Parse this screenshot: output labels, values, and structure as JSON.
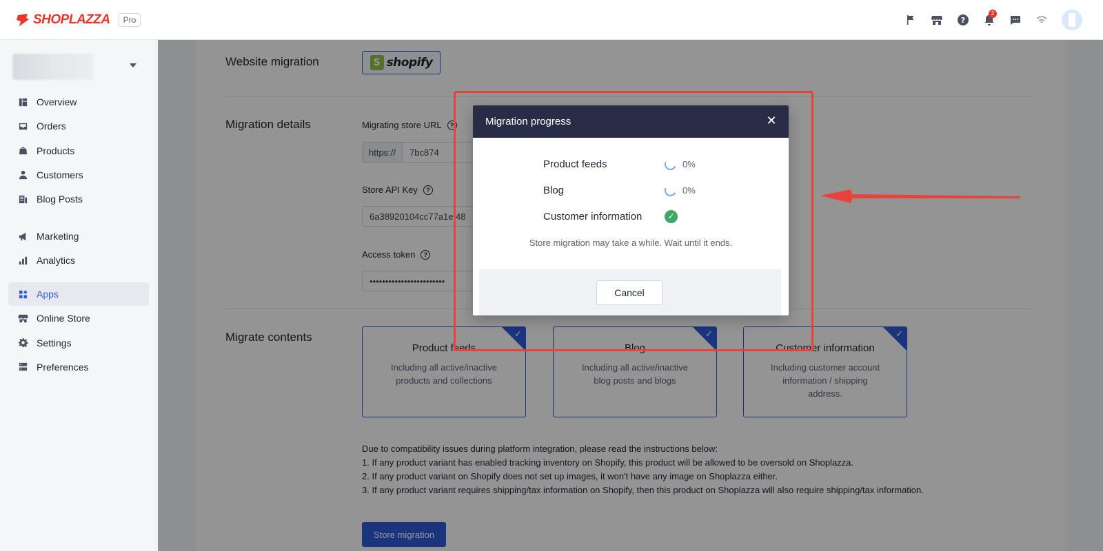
{
  "topbar": {
    "brand": "SHOPLAZZA",
    "plan_badge": "Pro",
    "icons": [
      "flag-icon",
      "store-icon",
      "help-icon",
      "bell-icon",
      "chat-icon",
      "wifi-icon"
    ],
    "notification_count": "2"
  },
  "sidebar": {
    "items": [
      {
        "label": "Overview",
        "icon": "overview-icon"
      },
      {
        "label": "Orders",
        "icon": "inbox-icon"
      },
      {
        "label": "Products",
        "icon": "tag-icon"
      },
      {
        "label": "Customers",
        "icon": "person-icon"
      },
      {
        "label": "Blog Posts",
        "icon": "blog-icon"
      },
      {
        "label": "Marketing",
        "icon": "megaphone-icon"
      },
      {
        "label": "Analytics",
        "icon": "bar-chart-icon"
      },
      {
        "label": "Apps",
        "icon": "apps-icon",
        "active": true
      },
      {
        "label": "Online Store",
        "icon": "storefront-icon"
      },
      {
        "label": "Settings",
        "icon": "gear-icon"
      },
      {
        "label": "Preferences",
        "icon": "preferences-icon"
      }
    ]
  },
  "main": {
    "website_migration": {
      "title": "Website migration",
      "platform": "shopify"
    },
    "details": {
      "title": "Migration details",
      "store_url_label": "Migrating store URL",
      "store_url_prefix": "https://",
      "store_url_value": "7bc874",
      "api_key_label": "Store API Key",
      "api_key_value": "6a38920104cc77a1ef48",
      "access_token_label": "Access token",
      "access_token_value": "••••••••••••••••••••••••"
    },
    "contents": {
      "title": "Migrate contents",
      "cards": [
        {
          "title": "Product feeds",
          "desc": "Including all active/inactive products and collections"
        },
        {
          "title": "Blog",
          "desc": "Including all active/inactive blog posts and blogs"
        },
        {
          "title": "Customer information",
          "desc": "Including customer account information / shipping address."
        }
      ]
    },
    "notes": [
      "Due to compatibility issues during platform integration, please read the instructions below:",
      "1. If any product variant has enabled tracking inventory on Shopify, this product will be allowed to be oversold on Shoplazza.",
      "2. If any product variant on Shopify does not set up images, it won't have any image on Shoplazza either.",
      "3. If any product variant requires shipping/tax information on Shopify, then this product on Shoplazza will also require shipping/tax information."
    ],
    "migrate_button": "Store migration"
  },
  "modal": {
    "title": "Migration progress",
    "rows": [
      {
        "label": "Product feeds",
        "status": "in-progress",
        "percent": "0%"
      },
      {
        "label": "Blog",
        "status": "in-progress",
        "percent": "0%"
      },
      {
        "label": "Customer information",
        "status": "done",
        "percent": ""
      }
    ],
    "note": "Store migration may take a while. Wait until it ends.",
    "cancel_label": "Cancel"
  },
  "colors": {
    "accent": "#2e5bd8",
    "brand": "#e8362b",
    "modal_header": "#282d45",
    "success": "#3fa66a",
    "annotation": "#e8433a"
  }
}
